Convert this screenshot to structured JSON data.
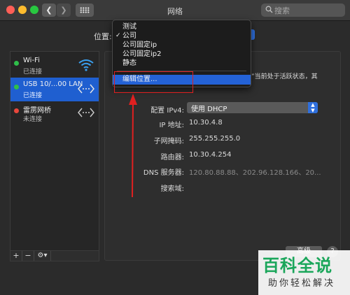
{
  "window": {
    "title": "网络"
  },
  "search": {
    "placeholder": "搜索"
  },
  "location": {
    "label": "位置:"
  },
  "location_menu": {
    "items": [
      {
        "label": "测试",
        "checked": false
      },
      {
        "label": "公司",
        "checked": true
      },
      {
        "label": "公司固定ip",
        "checked": false
      },
      {
        "label": "公司固定ip2",
        "checked": false
      },
      {
        "label": "静态",
        "checked": false
      }
    ],
    "edit_label": "编辑位置...",
    "check_mark": "✓"
  },
  "services": [
    {
      "name": "Wi-Fi",
      "status": "已连接",
      "status_color": "#2fbf4a",
      "icon": "wifi-icon"
    },
    {
      "name": "USB 10/...00 LAN",
      "status": "已连接",
      "status_color": "#2fbf4a",
      "icon": "ethernet-icon",
      "selected": true
    },
    {
      "name": "雷雳网桥",
      "status": "未连接",
      "status_color": "#e8473c",
      "icon": "ethernet-icon"
    }
  ],
  "sidebar_tools": {
    "add": "+",
    "remove": "−",
    "gear": "⚙▾"
  },
  "detail": {
    "status_snippet": "”当前处于活跃状态，其",
    "configure_label": "配置 IPv4:",
    "configure_value": "使用 DHCP",
    "ip_label": "IP 地址:",
    "ip_value": "10.30.4.8",
    "mask_label": "子网掩码:",
    "mask_value": "255.255.255.0",
    "router_label": "路由器:",
    "router_value": "10.30.4.254",
    "dns_label": "DNS 服务器:",
    "dns_value": "120.80.88.88、202.96.128.166、20...",
    "search_domain_label": "搜索域:",
    "advanced_label": "高级",
    "help_label": "?"
  },
  "watermark": {
    "main": "百科全说",
    "sub": "助你轻松解决"
  },
  "colors": {
    "accent": "#2462d6",
    "annotation": "#e02020",
    "watermark_green": "#1aa65a"
  }
}
